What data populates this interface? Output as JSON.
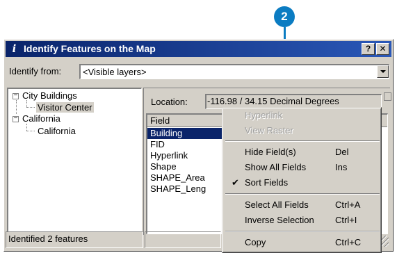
{
  "callout": {
    "number": "2",
    "color": "#0b7cc2"
  },
  "window": {
    "title": "Identify Features on the Map",
    "title_icon": "i",
    "help_button": "?",
    "close_button": "✕"
  },
  "identify_from": {
    "label": "Identify from:",
    "value": "<Visible layers>"
  },
  "tree": {
    "nodes": [
      {
        "label": "City Buildings",
        "expander": "−"
      },
      {
        "label": "Visitor Center"
      },
      {
        "label": "California",
        "expander": "−"
      },
      {
        "label": "California"
      }
    ]
  },
  "location": {
    "label": "Location:",
    "value": "-116.98 / 34.15 Decimal Degrees"
  },
  "grid": {
    "header": "Field",
    "rows": [
      "Building",
      "FID",
      "Hyperlink",
      "Shape",
      "SHAPE_Area",
      "SHAPE_Leng"
    ]
  },
  "status": {
    "text": "Identified 2 features"
  },
  "context_menu": {
    "hyperlink": "Hyperlink",
    "view_raster": "View Raster",
    "hide_fields": "Hide Field(s)",
    "hide_fields_shortcut": "Del",
    "show_all_fields": "Show All Fields",
    "show_all_fields_shortcut": "Ins",
    "sort_fields": "Sort Fields",
    "check": "✔",
    "select_all_fields": "Select All Fields",
    "select_all_fields_shortcut": "Ctrl+A",
    "inverse_selection": "Inverse Selection",
    "inverse_selection_shortcut": "Ctrl+I",
    "copy": "Copy",
    "copy_shortcut": "Ctrl+C"
  }
}
